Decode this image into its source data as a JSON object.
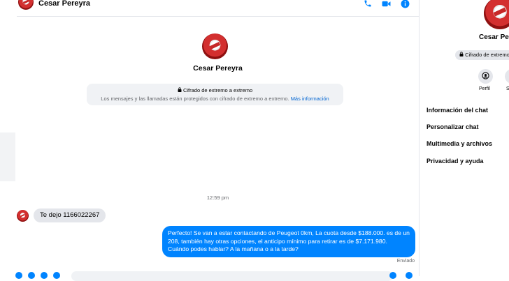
{
  "header": {
    "contact_name": "Cesar Pereyra"
  },
  "profile": {
    "name": "Cesar Pereyra"
  },
  "encryption": {
    "title": "Cifrado de extremo a extremo",
    "description": "Los mensajes y las llamadas están protegidos con cifrado de extremo a extremo.",
    "link": "Más información"
  },
  "conversation": {
    "timestamp": "12:59 pm",
    "incoming_message": "Te dejo 1166022267",
    "outgoing_message": "Perfecto!  Se van a estar contactando de Peugeot 0km, La cuota desde $188.000. es de un 208, también hay otras opciones, el anticipo mínimo para retirar es de $7.171.980. Cuándo podes hablar? A la mañana o a la tarde?",
    "status": "Enviado"
  },
  "sidebar": {
    "name": "Cesar Pereyra",
    "badge": "Cifrado de extremo a extremo",
    "actions": [
      {
        "label": "Perfil",
        "icon": "profile-icon"
      },
      {
        "label": "S",
        "icon": "silence-icon"
      }
    ],
    "menu": [
      "Información del chat",
      "Personalizar chat",
      "Multimedia y archivos",
      "Privacidad y ayuda"
    ]
  },
  "colors": {
    "accent": "#0084ff",
    "bubble_in": "#e4e6eb",
    "surface": "#f0f2f5",
    "link": "#0064d1"
  }
}
